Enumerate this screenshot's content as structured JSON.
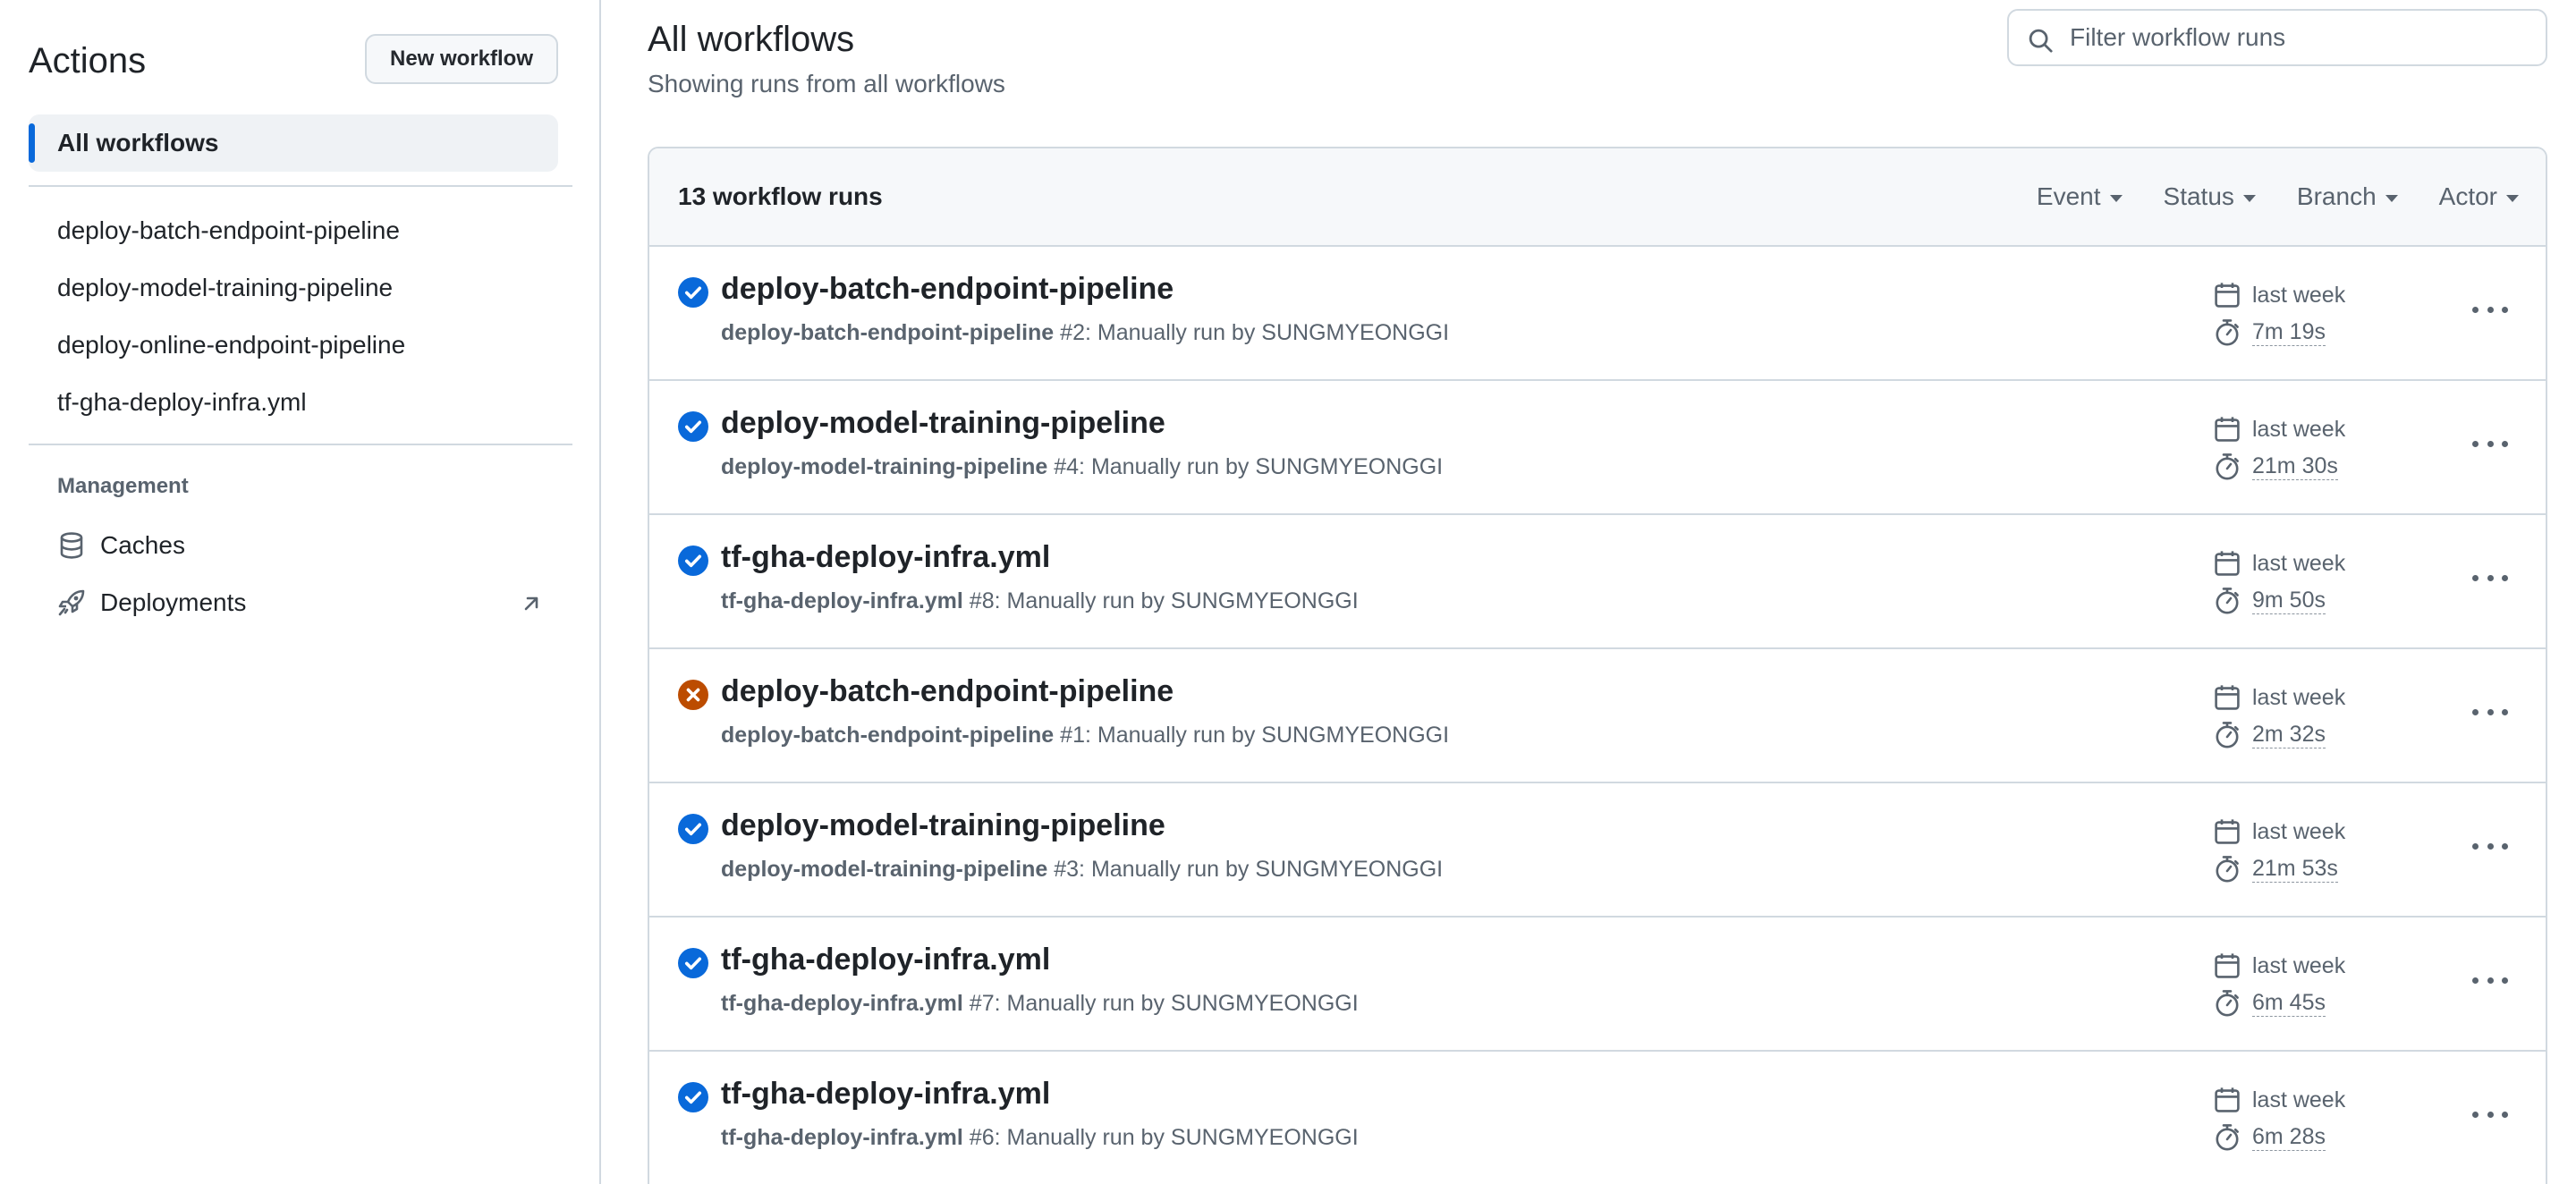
{
  "sidebar": {
    "title": "Actions",
    "new_workflow_label": "New workflow",
    "all_workflows_label": "All workflows",
    "workflows": [
      {
        "label": "deploy-batch-endpoint-pipeline"
      },
      {
        "label": "deploy-model-training-pipeline"
      },
      {
        "label": "deploy-online-endpoint-pipeline"
      },
      {
        "label": "tf-gha-deploy-infra.yml"
      }
    ],
    "management_label": "Management",
    "management_items": [
      {
        "label": "Caches",
        "icon": "database-icon"
      },
      {
        "label": "Deployments",
        "icon": "rocket-icon",
        "external": true
      }
    ]
  },
  "header": {
    "title": "All workflows",
    "subtitle": "Showing runs from all workflows",
    "filter_placeholder": "Filter workflow runs"
  },
  "runs_box": {
    "count_label": "13 workflow runs",
    "filters": [
      "Event",
      "Status",
      "Branch",
      "Actor"
    ]
  },
  "colors": {
    "success": "#0969da",
    "failure": "#bc4c00",
    "accent": "#0969da"
  },
  "runs": [
    {
      "status": "success",
      "title": "deploy-batch-endpoint-pipeline",
      "workflow": "deploy-batch-endpoint-pipeline",
      "detail": " #2: Manually run by SUNGMYEONGGI",
      "when": "last week",
      "duration": "7m 19s"
    },
    {
      "status": "success",
      "title": "deploy-model-training-pipeline",
      "workflow": "deploy-model-training-pipeline",
      "detail": " #4: Manually run by SUNGMYEONGGI",
      "when": "last week",
      "duration": "21m 30s"
    },
    {
      "status": "success",
      "title": "tf-gha-deploy-infra.yml",
      "workflow": "tf-gha-deploy-infra.yml",
      "detail": " #8: Manually run by SUNGMYEONGGI",
      "when": "last week",
      "duration": "9m 50s"
    },
    {
      "status": "failure",
      "title": "deploy-batch-endpoint-pipeline",
      "workflow": "deploy-batch-endpoint-pipeline",
      "detail": " #1: Manually run by SUNGMYEONGGI",
      "when": "last week",
      "duration": "2m 32s"
    },
    {
      "status": "success",
      "title": "deploy-model-training-pipeline",
      "workflow": "deploy-model-training-pipeline",
      "detail": " #3: Manually run by SUNGMYEONGGI",
      "when": "last week",
      "duration": "21m 53s"
    },
    {
      "status": "success",
      "title": "tf-gha-deploy-infra.yml",
      "workflow": "tf-gha-deploy-infra.yml",
      "detail": " #7: Manually run by SUNGMYEONGGI",
      "when": "last week",
      "duration": "6m 45s"
    },
    {
      "status": "success",
      "title": "tf-gha-deploy-infra.yml",
      "workflow": "tf-gha-deploy-infra.yml",
      "detail": " #6: Manually run by SUNGMYEONGGI",
      "when": "last week",
      "duration": "6m 28s"
    }
  ]
}
